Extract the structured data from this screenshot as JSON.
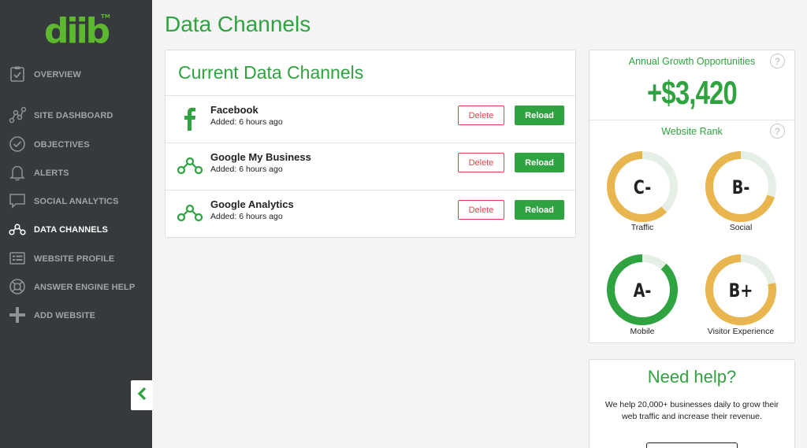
{
  "brand": {
    "logo_text": "diib",
    "trademark": "TM",
    "accent": "#2ea33f"
  },
  "sidebar": {
    "items": [
      {
        "label": "OVERVIEW",
        "icon": "clipboard-check-icon",
        "active": false
      },
      {
        "label": "SITE DASHBOARD",
        "icon": "nodes-graph-icon",
        "active": false
      },
      {
        "label": "OBJECTIVES",
        "icon": "circle-check-icon",
        "active": false
      },
      {
        "label": "ALERTS",
        "icon": "bell-icon",
        "active": false
      },
      {
        "label": "SOCIAL ANALYTICS",
        "icon": "chat-bubble-icon",
        "active": false
      },
      {
        "label": "DATA CHANNELS",
        "icon": "data-channels-icon",
        "active": true
      },
      {
        "label": "WEBSITE PROFILE",
        "icon": "profile-list-icon",
        "active": false
      },
      {
        "label": "ANSWER ENGINE HELP",
        "icon": "lifebuoy-icon",
        "active": false
      },
      {
        "label": "ADD WEBSITE",
        "icon": "plus-icon",
        "active": false
      }
    ]
  },
  "page": {
    "title": "Data Channels"
  },
  "channels": {
    "title": "Current Data Channels",
    "delete_label": "Delete",
    "reload_label": "Reload",
    "items": [
      {
        "name": "Facebook",
        "added": "Added: 6 hours ago",
        "icon": "facebook-icon"
      },
      {
        "name": "Google My Business",
        "added": "Added: 6 hours ago",
        "icon": "data-channels-icon"
      },
      {
        "name": "Google Analytics",
        "added": "Added: 6 hours ago",
        "icon": "data-channels-icon"
      }
    ]
  },
  "growth": {
    "title": "Annual Growth Opportunities",
    "value": "+$3,420",
    "help": "?"
  },
  "rank": {
    "title": "Website Rank",
    "help": "?",
    "gauges": [
      {
        "grade": "C-",
        "label": "Traffic",
        "fraction": 0.62,
        "color": "#e9b54f"
      },
      {
        "grade": "B-",
        "label": "Social",
        "fraction": 0.7,
        "color": "#e9b54f"
      },
      {
        "grade": "A-",
        "label": "Mobile",
        "fraction": 0.88,
        "color": "#2ea33f"
      },
      {
        "grade": "B+",
        "label": "Visitor Experience",
        "fraction": 0.78,
        "color": "#e9b54f"
      }
    ]
  },
  "help": {
    "title": "Need help?",
    "text": "We help 20,000+ businesses daily to grow their web traffic and increase their revenue."
  }
}
